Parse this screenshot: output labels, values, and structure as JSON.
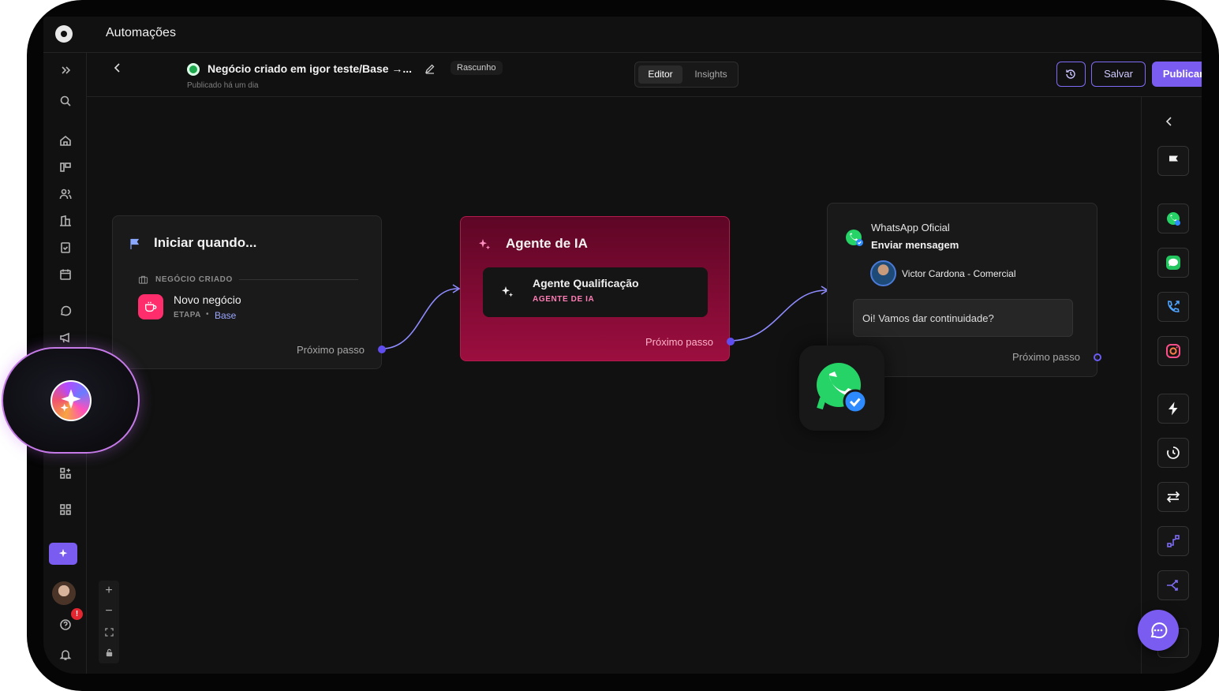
{
  "app": {
    "title": "Automações"
  },
  "header": {
    "flow_name": "Negócio criado em igor teste/Base →...",
    "flow_subtitle": "Publicado há um dia",
    "status_chip": "Rascunho",
    "tabs": [
      {
        "label": "Editor",
        "active": true
      },
      {
        "label": "Insights",
        "active": false
      }
    ],
    "save_label": "Salvar",
    "publish_label": "Publicar"
  },
  "sidebar": {
    "icons": [
      "expand-icon",
      "search-icon",
      "home-icon",
      "pipeline-icon",
      "contacts-icon",
      "company-icon",
      "tasks-icon",
      "calendar-icon",
      "chat-icon",
      "megaphone-icon",
      "apps-add-icon",
      "grid-icon",
      "ai-sparkle-icon",
      "avatar",
      "help-icon",
      "bell-icon"
    ],
    "notification_count": "!"
  },
  "nodes": {
    "trigger": {
      "title": "Iniciar quando...",
      "section_label": "NEGÓCIO CRIADO",
      "item_title": "Novo negócio",
      "item_stage_label": "ETAPA",
      "item_stage_sep": "•",
      "item_stage_value": "Base",
      "next_step": "Próximo passo"
    },
    "ai_agent": {
      "title": "Agente de IA",
      "agent_name": "Agente Qualificação",
      "agent_type": "AGENTE DE IA",
      "next_step": "Próximo passo"
    },
    "whatsapp": {
      "channel": "WhatsApp Oficial",
      "action": "Enviar mensagem",
      "sender": "Victor Cardona - Comercial",
      "message": "Oi! Vamos dar continuidade?",
      "next_step": "Próximo passo"
    }
  },
  "right_panel": {
    "tiles": [
      "flag-icon",
      "whatsapp-icon",
      "imessage-icon",
      "phone-icon",
      "instagram-icon",
      "lightning-icon",
      "timer-icon",
      "swap-icon",
      "route-icon",
      "split-icon"
    ]
  },
  "zoom_controls": {
    "zoom_in": "+",
    "zoom_out": "−"
  },
  "colors": {
    "accent": "#7b5cf0",
    "ai_node": "#9c0e3f",
    "whatsapp": "#25d366",
    "success": "#1ea84d"
  }
}
